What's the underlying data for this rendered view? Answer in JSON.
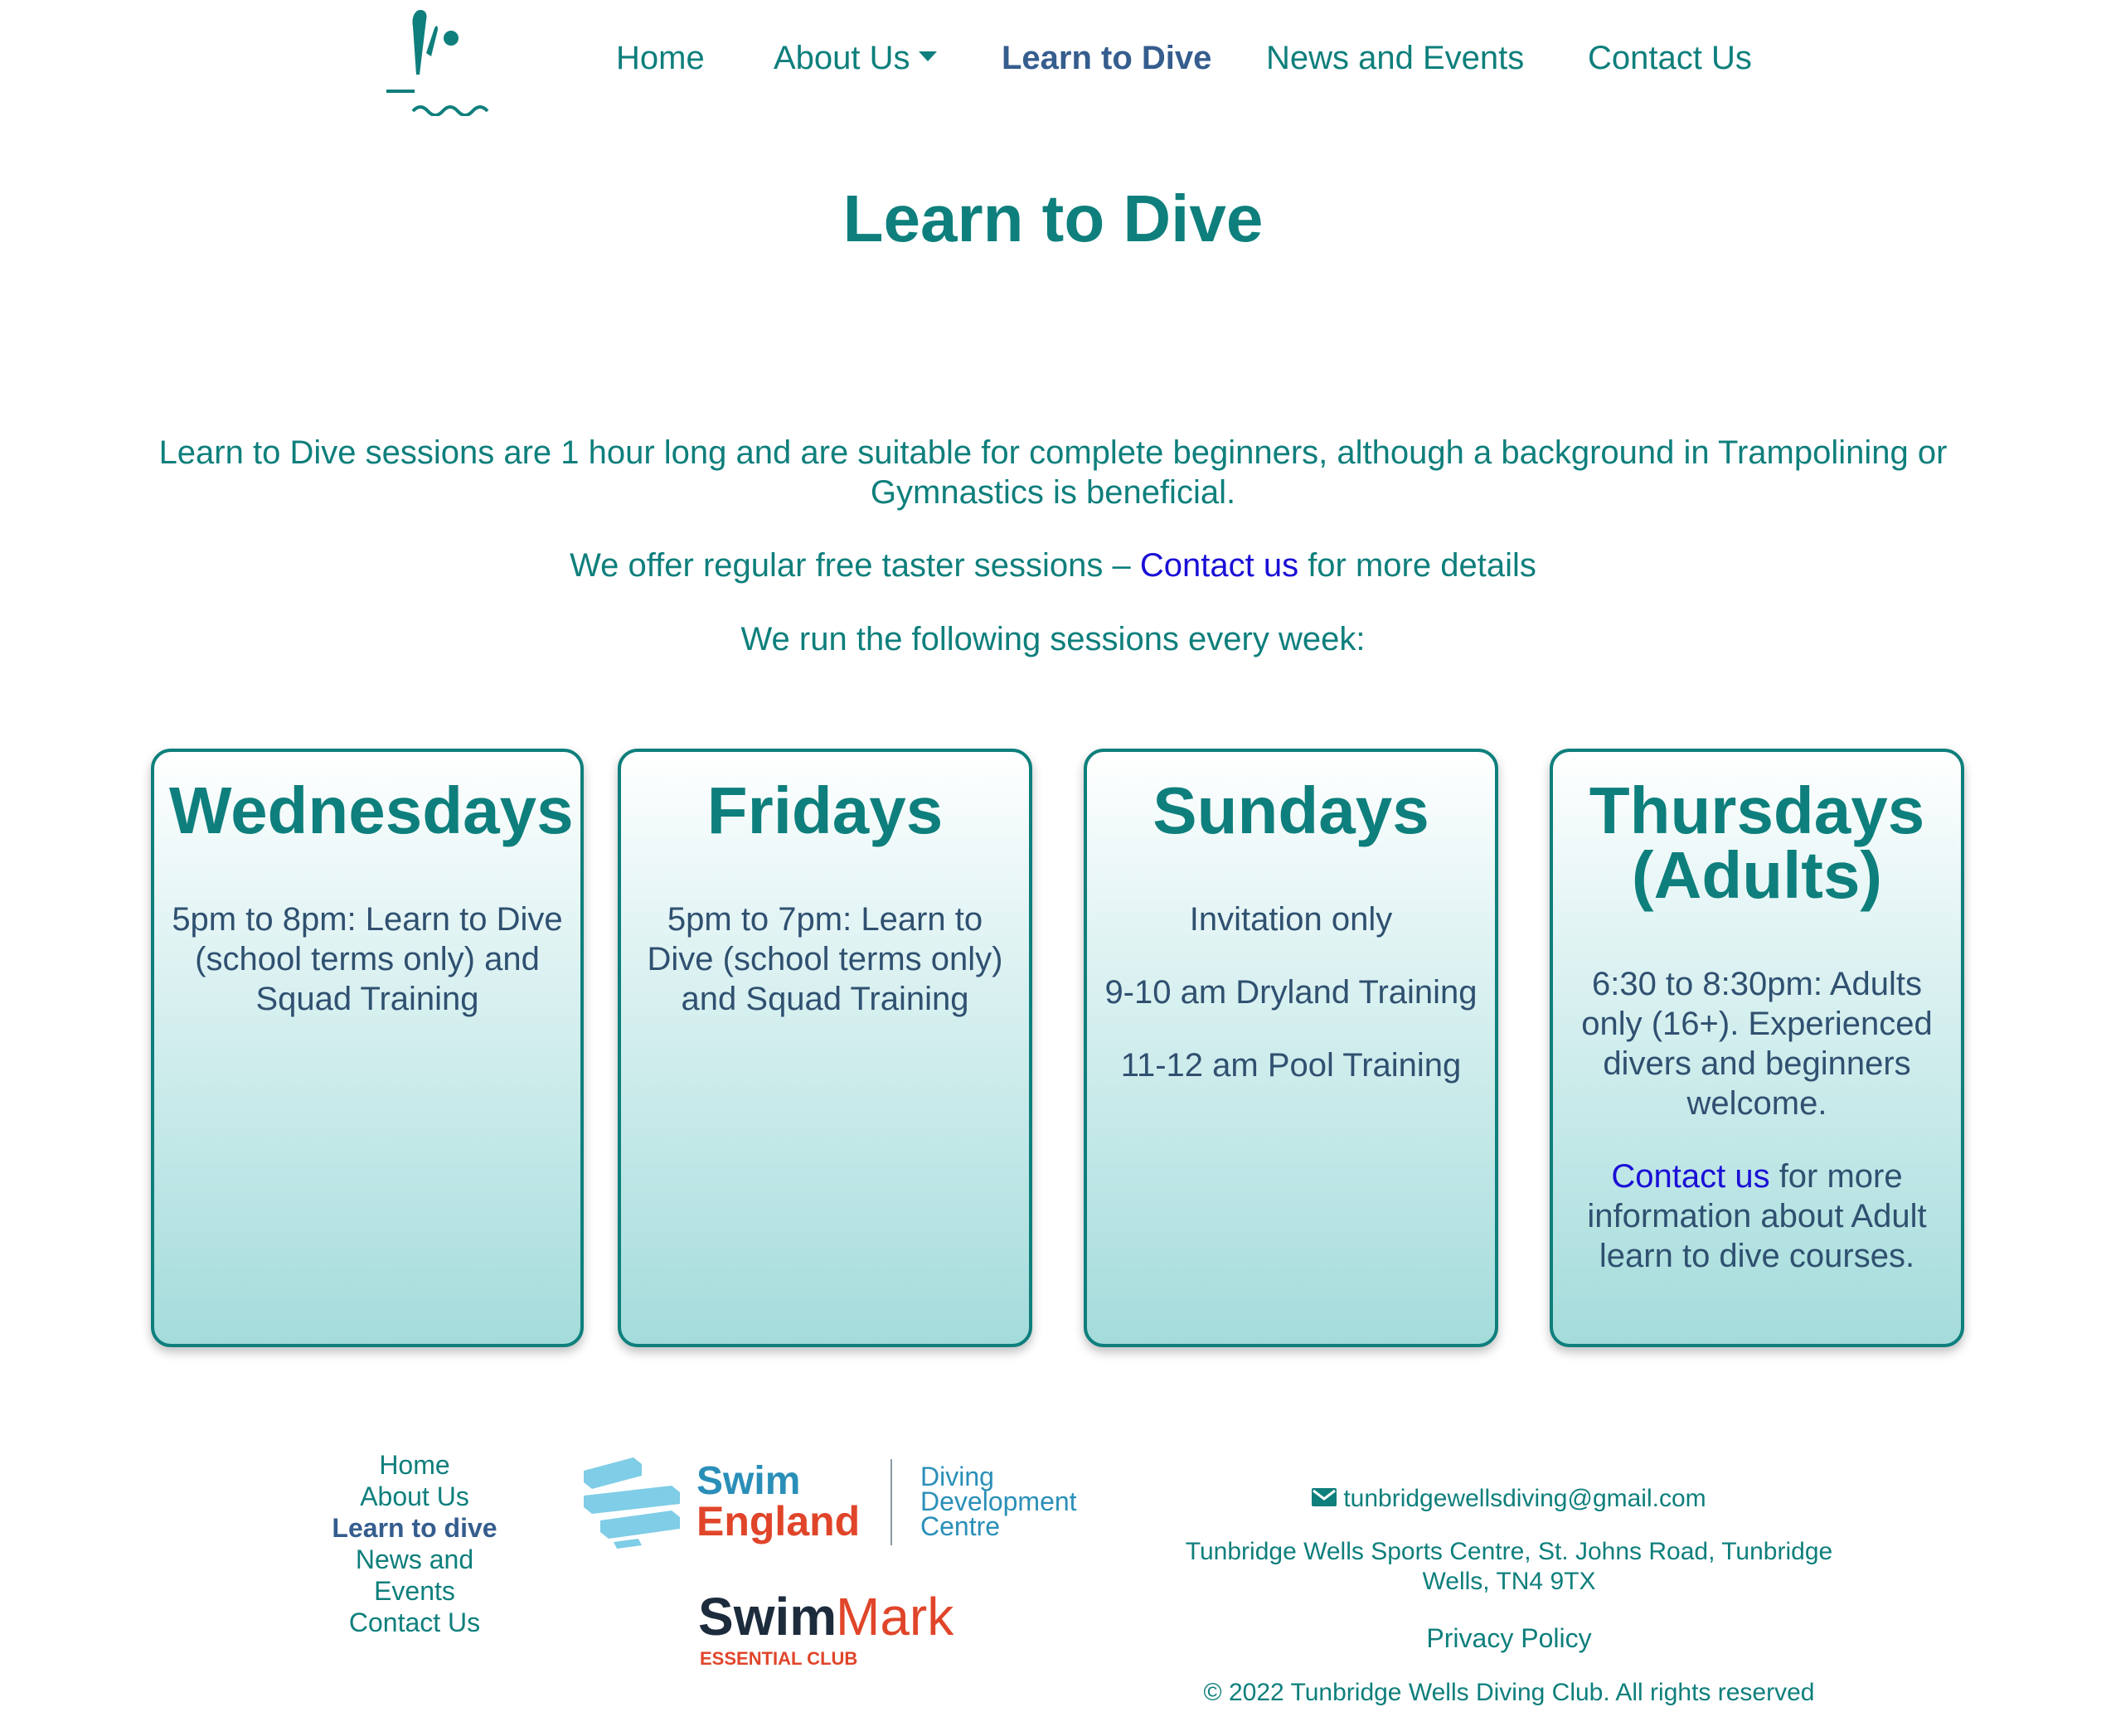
{
  "nav": {
    "items": [
      {
        "label": "Home"
      },
      {
        "label": "About Us"
      },
      {
        "label": "Learn to Dive"
      },
      {
        "label": "News and Events"
      },
      {
        "label": "Contact Us"
      }
    ]
  },
  "page": {
    "title": "Learn to Dive"
  },
  "intro": {
    "para1": "Learn to Dive sessions are 1 hour long and are suitable for complete beginners, although a background in Trampolining or Gymnastics is beneficial.",
    "para2_before": "We offer regular free taster sessions – ",
    "para2_link": "Contact us",
    "para2_after": " for more details",
    "para3": "We run the following sessions every week:"
  },
  "cards": [
    {
      "title": "Wednesdays",
      "lines": [
        "5pm to 8pm: Learn to Dive (school terms only) and Squad Training"
      ]
    },
    {
      "title": "Fridays",
      "lines": [
        "5pm to 7pm: Learn to Dive (school terms only) and Squad Training"
      ]
    },
    {
      "title": "Sundays",
      "lines": [
        "Invitation only",
        "9-10 am Dryland Training",
        "11-12 am Pool Training"
      ]
    },
    {
      "title": "Thursdays (Adults)",
      "lines": [
        "6:30 to 8:30pm: Adults only (16+). Experienced divers and beginners welcome."
      ],
      "link": "Contact us",
      "link_after": " for more information about Adult learn to dive courses."
    }
  ],
  "footer": {
    "nav": [
      "Home",
      "About Us",
      "Learn to dive",
      "News and Events",
      "Contact Us"
    ],
    "swim_england": {
      "line1": "Swim",
      "line2": "England",
      "ddc1": "Diving",
      "ddc2": "Development",
      "ddc3": "Centre"
    },
    "swimmark": {
      "swim": "Swim",
      "mark": "Mark",
      "sub": "ESSENTIAL CLUB"
    },
    "email": "tunbridgewellsdiving@gmail.com",
    "address": "Tunbridge Wells Sports Centre, St. Johns Road, Tunbridge Wells, TN4 9TX",
    "privacy": "Privacy Policy",
    "copyright": "© 2022 Tunbridge Wells Diving Club. All rights reserved"
  },
  "colors": {
    "teal": "#0e7f7c",
    "active_nav": "#355d8e",
    "link": "#1a0fd6",
    "card_text": "#2f5070"
  }
}
